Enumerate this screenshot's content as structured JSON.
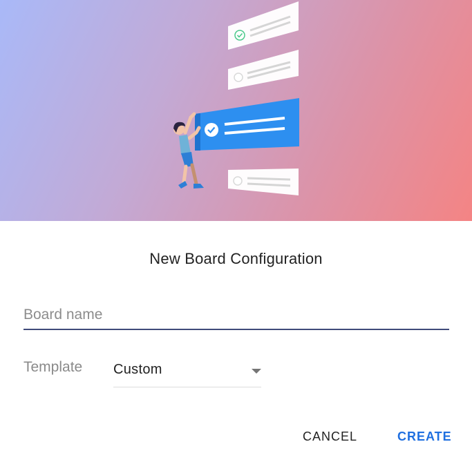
{
  "dialog": {
    "title": "New Board Configuration",
    "board_name": {
      "value": "",
      "placeholder": "Board name"
    },
    "template": {
      "label": "Template",
      "selected": "Custom"
    },
    "actions": {
      "cancel_label": "CANCEL",
      "create_label": "CREATE"
    }
  },
  "colors": {
    "accent": "#1f6fe0",
    "card_highlight": "#2d8ff0",
    "hero_gradient": [
      "#a9b9f8",
      "#dc93a8",
      "#f48484"
    ]
  },
  "icons": {
    "hero": "board-illustration",
    "dropdown": "caret-down-icon"
  }
}
